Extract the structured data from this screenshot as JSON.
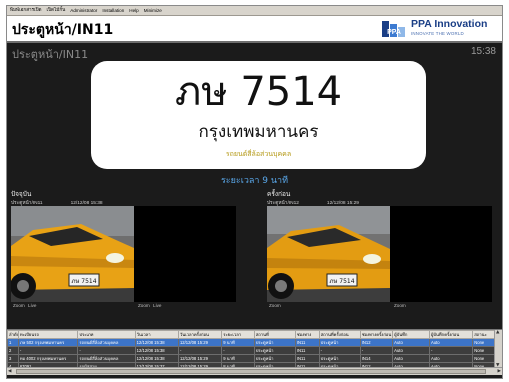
{
  "menubar": {
    "items": [
      "พิมพ์เอกสารเปิด",
      "เปิดไม้กั้น",
      "Administrator",
      "Installation",
      "Help",
      "Minimize"
    ]
  },
  "header": {
    "title": "ประตูหน้า/IN11",
    "brand": "PPA Innovation",
    "tagline": "INNOVATE THE WORLD",
    "logo_text": "PPA",
    "brand_color": "#1a3e86"
  },
  "gate_label": "ประตูหน้า/IN11",
  "clock": "15:38",
  "plate": {
    "number": "ภษ 7514",
    "province": "กรุงเทพมหานคร",
    "vehicle_type": "รถยนต์สี่ล้อส่วนบุคคล"
  },
  "duration": "ระยะเวลา 9 นาที",
  "cameras": {
    "current": {
      "heading": "ปัจจุบัน",
      "gate": "ประตูหน้า/IN11",
      "timestamp": "12/12/08 15:38",
      "plate_text": "ภษ 7514",
      "zoom_label": "Zoom",
      "live_label": "Live",
      "zoom2_label": "Zoom",
      "live2_label": "Live"
    },
    "previous": {
      "heading": "ครั้งก่อน",
      "gate": "ประตูหน้า/IN12",
      "timestamp": "12/12/08 15:29",
      "plate_text": "ภษ 7514",
      "zoom_label": "Zoom",
      "zoom2_label": "Zoom"
    }
  },
  "table": {
    "columns": [
      "ลำดับ",
      "ทะเบียนรถ",
      "ประเภท",
      "วันเวลา",
      "วันเวลาครั้งก่อน",
      "ระยะเวลา",
      "สถานที่",
      "ช่องทาง",
      "สถานที่ครั้งก่อน",
      "ช่องทางครั้งก่อน",
      "ผู้บันทึก",
      "ผู้บันทึกครั้งก่อน",
      "สถานะ"
    ],
    "rows": [
      [
        "1",
        "ภษ 502 กรุงเทพมหานคร",
        "รถยนต์สี่ล้อส่วนบุคคล",
        "12/12/08 15:38",
        "12/12/08 15:29",
        "9 นาที",
        "ประตูหน้า",
        "IN11",
        "ประตูหน้า",
        "IN12",
        "Auto",
        "Auto",
        "None"
      ],
      [
        "2",
        "-",
        "-",
        "12/12/08 15:38",
        "-",
        "-",
        "ประตูหน้า",
        "IN11",
        "-",
        "-",
        "Auto",
        "-",
        "None"
      ],
      [
        "3",
        "ทอ 4002 กรุงเทพมหานคร",
        "รถยนต์สี่ล้อส่วนบุคคล",
        "12/12/08 15:38",
        "12/12/08 15:29",
        "9 นาที",
        "ประตูหน้า",
        "IN11",
        "ประตูหน้า",
        "IN14",
        "Auto",
        "Auto",
        "None"
      ],
      [
        "4",
        "67091",
        "รถบัสสาย",
        "12/12/08 15:37",
        "12/12/08 15:29",
        "8 นาที",
        "ประตูหน้า",
        "IN11",
        "ประตูหน้า",
        "IN12",
        "Auto",
        "Auto",
        "None"
      ]
    ]
  },
  "colors": {
    "background": "#1b1b1b",
    "accent_blue": "#5aa8ea",
    "vehicle_type": "#b59a18",
    "selected_row": "#3c74c8"
  }
}
